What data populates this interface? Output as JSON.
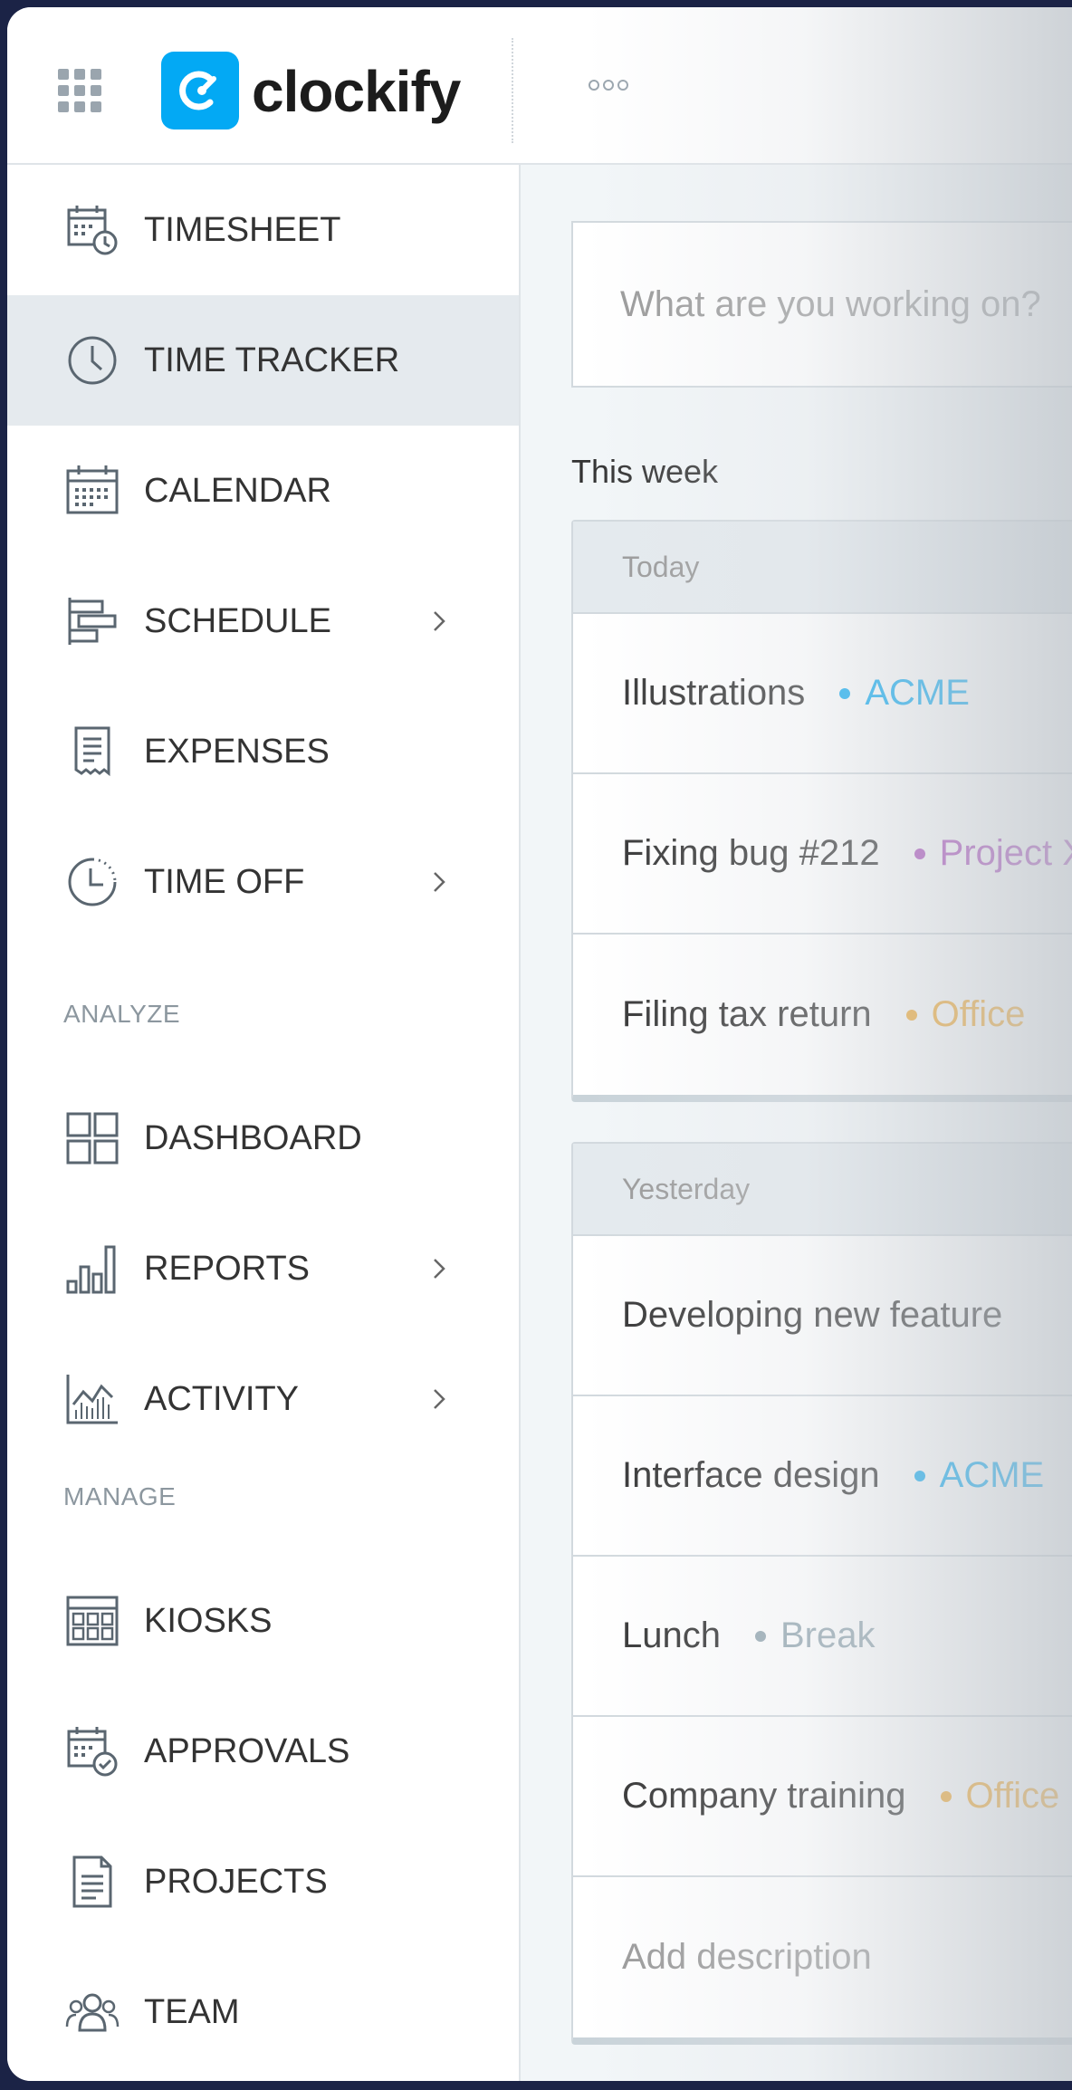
{
  "header": {
    "logo_text": "clockify"
  },
  "sidebar": {
    "items": [
      {
        "label": "TIMESHEET"
      },
      {
        "label": "TIME TRACKER"
      },
      {
        "label": "CALENDAR"
      },
      {
        "label": "SCHEDULE"
      },
      {
        "label": "EXPENSES"
      },
      {
        "label": "TIME OFF"
      },
      {
        "label": "DASHBOARD"
      },
      {
        "label": "REPORTS"
      },
      {
        "label": "ACTIVITY"
      },
      {
        "label": "KIOSKS"
      },
      {
        "label": "APPROVALS"
      },
      {
        "label": "PROJECTS"
      },
      {
        "label": "TEAM"
      }
    ],
    "sections": {
      "analyze": "ANALYZE",
      "manage": "MANAGE"
    }
  },
  "main": {
    "input_placeholder": "What are you working on?",
    "week_label": "This week",
    "days": [
      {
        "label": "Today",
        "entries": [
          {
            "description": "Illustrations",
            "project": "ACME",
            "color": "#03a9f4"
          },
          {
            "description": "Fixing bug #212",
            "project": "Project X",
            "color": "#9c27b0"
          },
          {
            "description": "Filing tax return",
            "project": "Office",
            "color": "#ff9800"
          }
        ]
      },
      {
        "label": "Yesterday",
        "entries": [
          {
            "description": "Developing new feature",
            "project": "",
            "color": ""
          },
          {
            "description": "Interface design",
            "project": "ACME",
            "color": "#03a9f4"
          },
          {
            "description": "Lunch",
            "project": "Break",
            "color": "#607d8b"
          },
          {
            "description": "Company training",
            "project": "Office",
            "color": "#ff9800"
          },
          {
            "description": "Add description",
            "project": "",
            "color": ""
          }
        ]
      }
    ]
  },
  "colors": {
    "accent": "#03a9f4",
    "active_nav_bg": "#e5eaee",
    "main_bg": "#f2f6f8"
  }
}
